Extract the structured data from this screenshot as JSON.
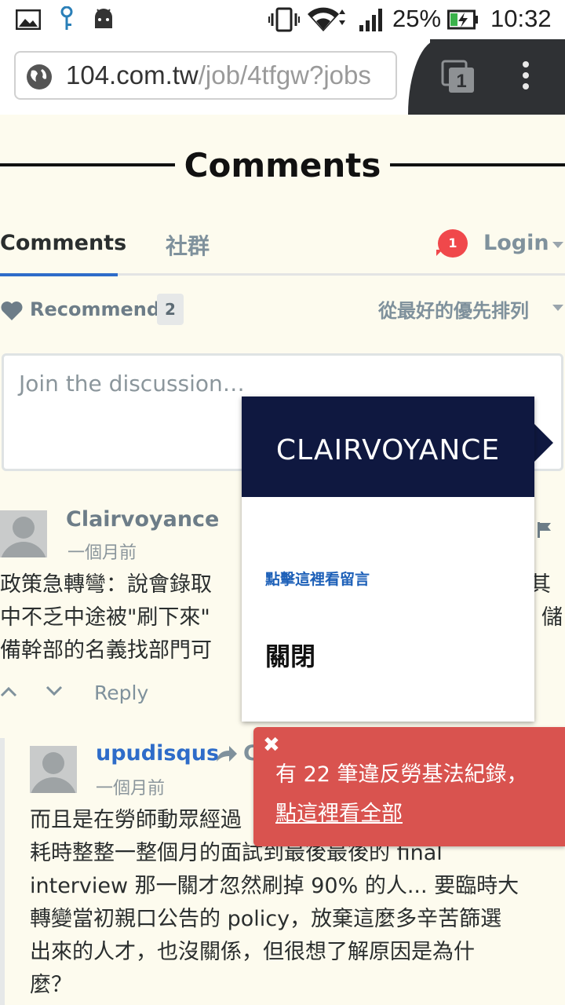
{
  "status_bar": {
    "battery": "25%",
    "time": "10:32",
    "icons": [
      "image-icon",
      "key-icon",
      "android-icon",
      "vibrate-icon",
      "wifi-icon",
      "signal-icon",
      "battery-charging-icon"
    ]
  },
  "browser": {
    "url_host": "104.com.tw",
    "url_path": "/job/4tfgw?jobs",
    "tab_count": "1",
    "icons": [
      "globe-icon",
      "tabs-icon",
      "menu-dots-icon"
    ]
  },
  "header": {
    "title": "Comments"
  },
  "tabs": {
    "comments": "Comments",
    "community": "社群",
    "notification_count": "1",
    "login": "Login"
  },
  "recommend": {
    "label": "Recommend",
    "count": "2"
  },
  "sort": {
    "label": "從最好的優先排列"
  },
  "discussion": {
    "placeholder": "Join the discussion…"
  },
  "comments": [
    {
      "author": "Clairvoyance",
      "time": "一個月前",
      "lines": [
        "政策急轉彎：說會錄取　　　　　　　　　　　　　　　其",
        "中不乏中途被\"刷下來\"",
        "備幹部的名義找部門可"
      ],
      "line1_end": "其",
      "line2_end": "儲",
      "reply": "Reply"
    },
    {
      "author": "upudisqus",
      "reply_to_initial": "C",
      "time": "一個月前",
      "lines": [
        "而且是在勞師動眾經過",
        "耗時整整一整個月的面試到最後最後的 final",
        "interview 那一關才忽然刷掉 90% 的人... 要臨時大",
        "轉變當初親口公告的 policy，放棄這麼多辛苦篩選",
        "出來的人才，也沒關係，但很想了解原因是為什",
        "麼？"
      ]
    }
  ],
  "popup": {
    "title": "CLAIRVOYANCE",
    "link": "點擊這裡看留言",
    "close": "關閉"
  },
  "toast": {
    "message": "有 22 筆違反勞基法紀錄，",
    "link": "點這裡看全部"
  }
}
